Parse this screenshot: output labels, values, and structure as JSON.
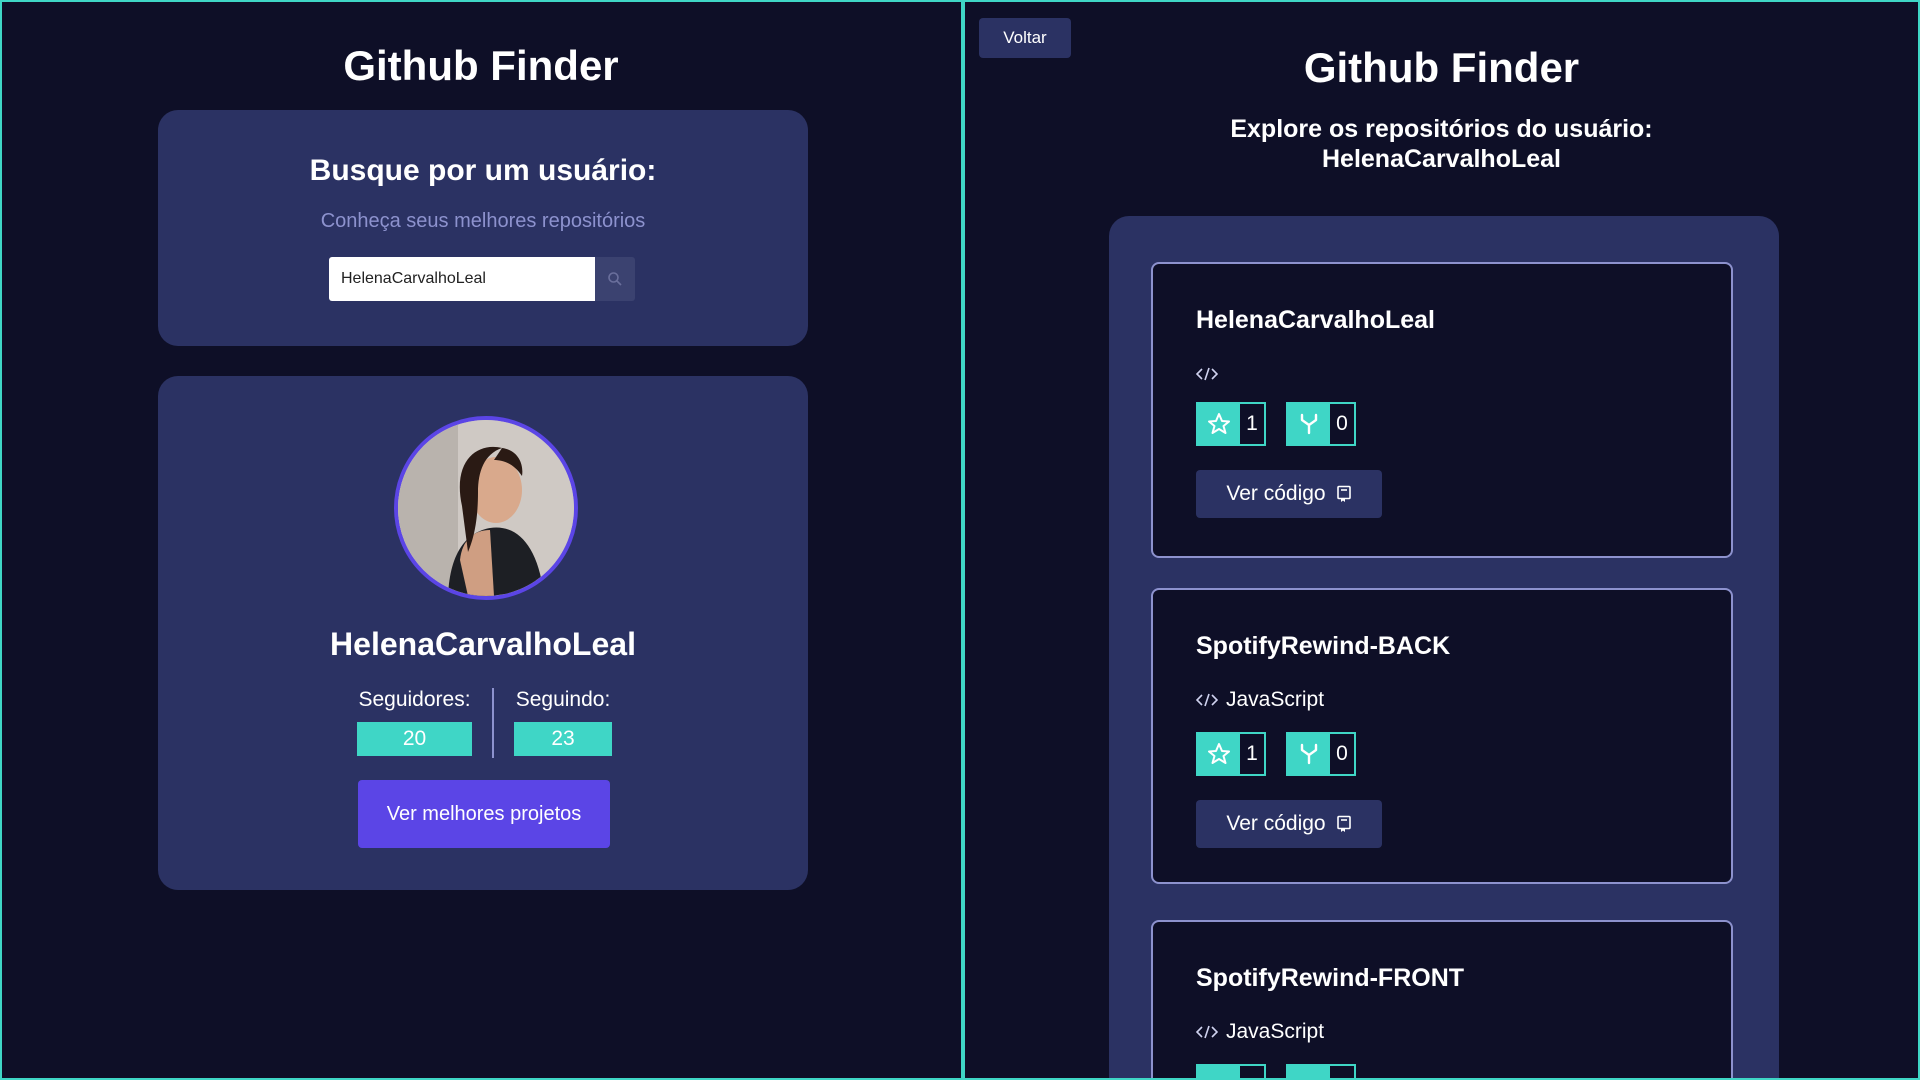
{
  "colors": {
    "background": "#0e0f27",
    "card": "#2b3263",
    "accent_teal": "#3fd6c6",
    "accent_purple": "#5b45e6",
    "muted_text": "#8d92ce"
  },
  "left": {
    "title": "Github Finder",
    "search": {
      "heading": "Busque por um usuário:",
      "subtitle": "Conheça seus melhores repositórios",
      "input_value": "HelenaCarvalhoLeal",
      "button_icon": "search-icon"
    },
    "profile": {
      "avatar_icon": "avatar",
      "name": "HelenaCarvalhoLeal",
      "followers_label": "Seguidores:",
      "followers_value": "20",
      "following_label": "Seguindo:",
      "following_value": "23",
      "button_label": "Ver melhores projetos"
    }
  },
  "right": {
    "back_label": "Voltar",
    "title": "Github Finder",
    "explore_line1": "Explore os repositórios do usuário:",
    "explore_line2": "HelenaCarvalhoLeal",
    "repos": [
      {
        "name": "HelenaCarvalhoLeal",
        "language": "",
        "stars": "1",
        "forks": "0",
        "code_label": "Ver código"
      },
      {
        "name": "SpotifyRewind-BACK",
        "language": "JavaScript",
        "stars": "1",
        "forks": "0",
        "code_label": "Ver código"
      },
      {
        "name": "SpotifyRewind-FRONT",
        "language": "JavaScript",
        "stars": "",
        "forks": "",
        "code_label": ""
      }
    ]
  }
}
